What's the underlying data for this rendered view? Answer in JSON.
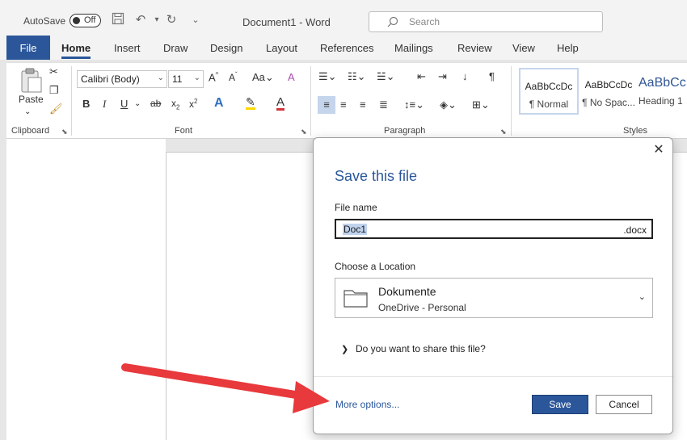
{
  "titlebar": {
    "autosave_label": "AutoSave",
    "autosave_state": "Off",
    "doc_title": "Document1  -  Word",
    "search_placeholder": "Search"
  },
  "tabs": [
    "File",
    "Home",
    "Insert",
    "Draw",
    "Design",
    "Layout",
    "References",
    "Mailings",
    "Review",
    "View",
    "Help"
  ],
  "active_tab": "Home",
  "ribbon": {
    "clipboard": {
      "paste_label": "Paste",
      "group_label": "Clipboard"
    },
    "font": {
      "font_name": "Calibri (Body)",
      "font_size": "11",
      "group_label": "Font"
    },
    "paragraph": {
      "group_label": "Paragraph"
    },
    "styles": {
      "group_label": "Styles",
      "items": [
        {
          "sample": "AaBbCcDc",
          "name": "¶ Normal"
        },
        {
          "sample": "AaBbCcDc",
          "name": "¶ No Spac..."
        },
        {
          "sample": "AaBbCc",
          "name": "Heading 1"
        }
      ]
    }
  },
  "dialog": {
    "title": "Save this file",
    "file_name_label": "File name",
    "file_name_value": "Doc1",
    "file_ext": ".docx",
    "location_label": "Choose a Location",
    "location_name": "Dokumente",
    "location_sub": "OneDrive - Personal",
    "share_question": "Do you want to share this file?",
    "more_options": "More options...",
    "save_button": "Save",
    "cancel_button": "Cancel"
  },
  "colors": {
    "accent": "#2b579a",
    "arrow": "#e8393c"
  }
}
